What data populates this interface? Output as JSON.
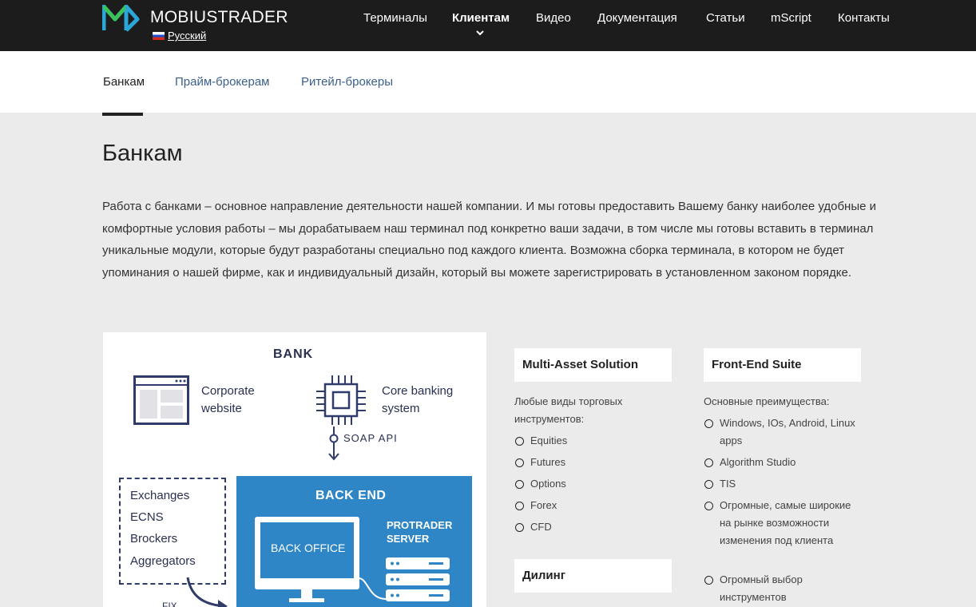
{
  "header": {
    "brand": "MOBIUSTRADER",
    "language": "Русский",
    "nav": [
      "Терминалы",
      "Клиентам",
      "Видео",
      "Документация",
      "Статьи",
      "mScript",
      "Контакты"
    ],
    "active_nav": "Клиентам"
  },
  "subnav": {
    "items": [
      "Банкам",
      "Прайм-брокерам",
      "Ритейл-брокеры"
    ],
    "active": "Банкам"
  },
  "page": {
    "title": "Банкам",
    "intro": "Работа с банками – основное направление деятельности нашей компании. И мы готовы предоставить Вашему банку наиболее удобные и комфортные условия работы – мы дорабатываем наш терминал под конкретно ваши задачи, в том числе мы готовы вставить в терминал уникальные модули, которые будут разработаны специально под каждого клиента.  Возможна сборка терминала, в котором не будет упоминания о нашей фирме, как и индивидуальный дизайн, который вы можете зарегистрировать в установленном законом порядке."
  },
  "diagram": {
    "bank": "BANK",
    "corporate_line1": "Corporate",
    "corporate_line2": "website",
    "core_line1": "Core banking",
    "core_line2": "system",
    "soap": "SOAP  API",
    "external": [
      "Exchanges",
      "ECNS",
      "Brockers",
      "Aggregators"
    ],
    "back_end": "BACK END",
    "back_office": "BACK OFFICE",
    "protrader_line1": "PROTRADER",
    "protrader_line2": "SERVER",
    "fix": "FIX",
    "colors": {
      "navy": "#2f3b6b",
      "blue": "#2f86c6",
      "green": "#3cc25a"
    }
  },
  "multi_asset": {
    "heading": "Multi-Asset Solution",
    "intro": "Любые виды торговых инструментов:",
    "items": [
      "Equities",
      "Futures",
      "Options",
      "Forex",
      "CFD"
    ]
  },
  "dealing": {
    "heading": "Дилинг"
  },
  "frontend": {
    "heading": "Front-End Suite",
    "intro": "Основные преимущества:",
    "items": [
      "Windows, IOs, Android, Linux apps",
      "Algorithm Studio",
      "TIS",
      "Огромные, самые широкие на рынке возможности изменения под клиента",
      "Огромный выбор инструментов"
    ]
  }
}
